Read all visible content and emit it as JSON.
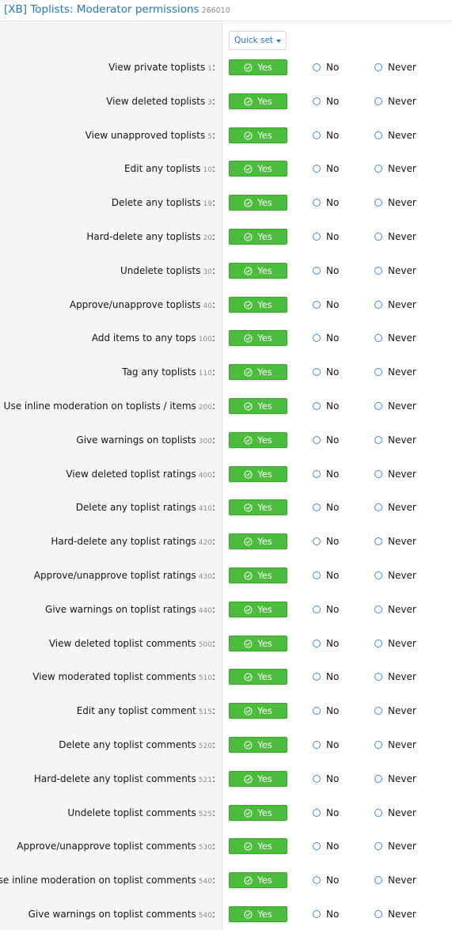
{
  "header": {
    "title": "[XB] Toplists: Moderator permissions",
    "id": "266010"
  },
  "quick_set": {
    "label": "Quick set"
  },
  "options": {
    "yes": "Yes",
    "no": "No",
    "never": "Never"
  },
  "colors": {
    "accent": "#2577b1",
    "yes_green": "#4bbc3b",
    "radio_border": "#3c8ccd"
  },
  "permissions": [
    {
      "label": "View private toplists",
      "num": "1",
      "value": "yes"
    },
    {
      "label": "View deleted toplists",
      "num": "3",
      "value": "yes"
    },
    {
      "label": "View unapproved toplists",
      "num": "5",
      "value": "yes"
    },
    {
      "label": "Edit any toplists",
      "num": "10",
      "value": "yes"
    },
    {
      "label": "Delete any toplists",
      "num": "19",
      "value": "yes"
    },
    {
      "label": "Hard-delete any toplists",
      "num": "20",
      "value": "yes"
    },
    {
      "label": "Undelete toplists",
      "num": "30",
      "value": "yes"
    },
    {
      "label": "Approve/unapprove toplists",
      "num": "40",
      "value": "yes"
    },
    {
      "label": "Add items to any tops",
      "num": "100",
      "value": "yes"
    },
    {
      "label": "Tag any toplists",
      "num": "110",
      "value": "yes"
    },
    {
      "label": "Use inline moderation on toplists / items",
      "num": "200",
      "value": "yes"
    },
    {
      "label": "Give warnings on toplists",
      "num": "300",
      "value": "yes"
    },
    {
      "label": "View deleted toplist ratings",
      "num": "400",
      "value": "yes"
    },
    {
      "label": "Delete any toplist ratings",
      "num": "410",
      "value": "yes"
    },
    {
      "label": "Hard-delete any toplist ratings",
      "num": "420",
      "value": "yes"
    },
    {
      "label": "Approve/unapprove toplist ratings",
      "num": "430",
      "value": "yes"
    },
    {
      "label": "Give warnings on toplist ratings",
      "num": "440",
      "value": "yes"
    },
    {
      "label": "View deleted toplist comments",
      "num": "500",
      "value": "yes"
    },
    {
      "label": "View moderated toplist comments",
      "num": "510",
      "value": "yes"
    },
    {
      "label": "Edit any toplist comment",
      "num": "515",
      "value": "yes"
    },
    {
      "label": "Delete any toplist comments",
      "num": "520",
      "value": "yes"
    },
    {
      "label": "Hard-delete any toplist comments",
      "num": "521",
      "value": "yes"
    },
    {
      "label": "Undelete toplist comments",
      "num": "525",
      "value": "yes"
    },
    {
      "label": "Approve/unapprove toplist comments",
      "num": "530",
      "value": "yes"
    },
    {
      "label": "Use inline moderation on toplist comments",
      "num": "540",
      "value": "yes"
    },
    {
      "label": "Give warnings on toplist comments",
      "num": "540",
      "value": "yes"
    }
  ]
}
